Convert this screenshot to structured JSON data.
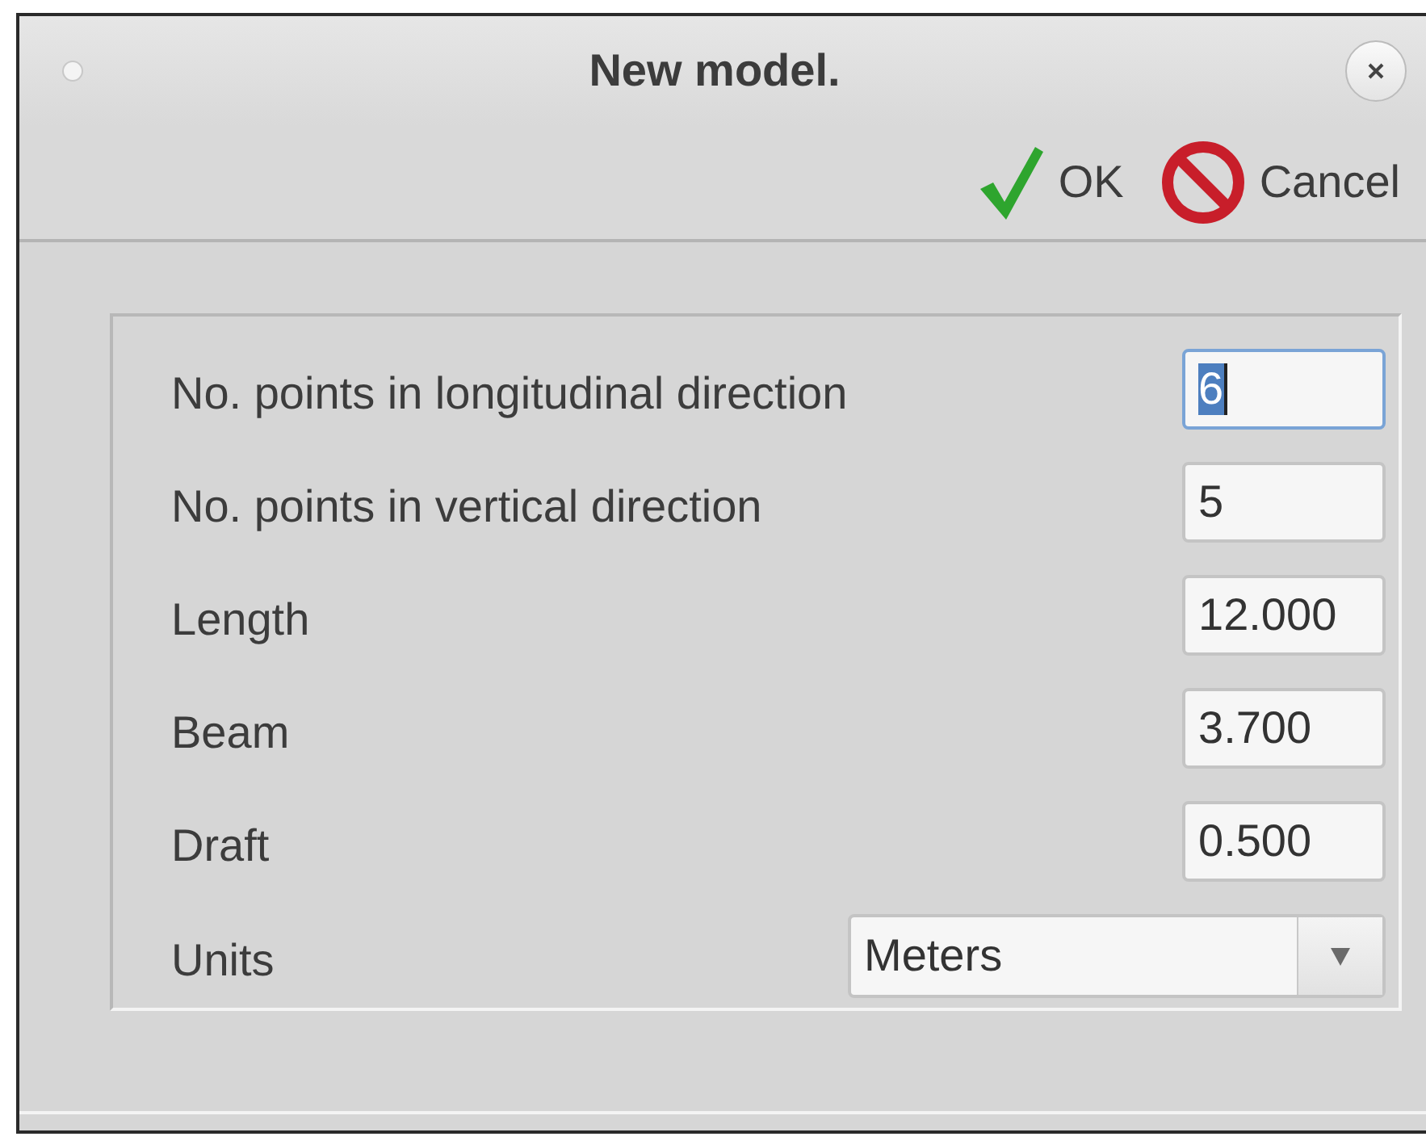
{
  "window": {
    "title": "New model."
  },
  "toolbar": [
    {
      "kind": "ok",
      "label": "OK"
    },
    {
      "kind": "cancel",
      "label": "Cancel"
    }
  ],
  "fields": [
    {
      "kind": "text",
      "label": "No. points in longitudinal direction",
      "value": "6",
      "focused": true
    },
    {
      "kind": "text",
      "label": "No. points in vertical direction",
      "value": "5",
      "focused": false
    },
    {
      "kind": "text",
      "label": "Length",
      "value": "12.000",
      "focused": false
    },
    {
      "kind": "text",
      "label": "Beam",
      "value": "3.700",
      "focused": false
    },
    {
      "kind": "text",
      "label": "Draft",
      "value": "0.500",
      "focused": false
    },
    {
      "kind": "combo",
      "label": "Units",
      "value": "Meters",
      "focused": false
    }
  ]
}
